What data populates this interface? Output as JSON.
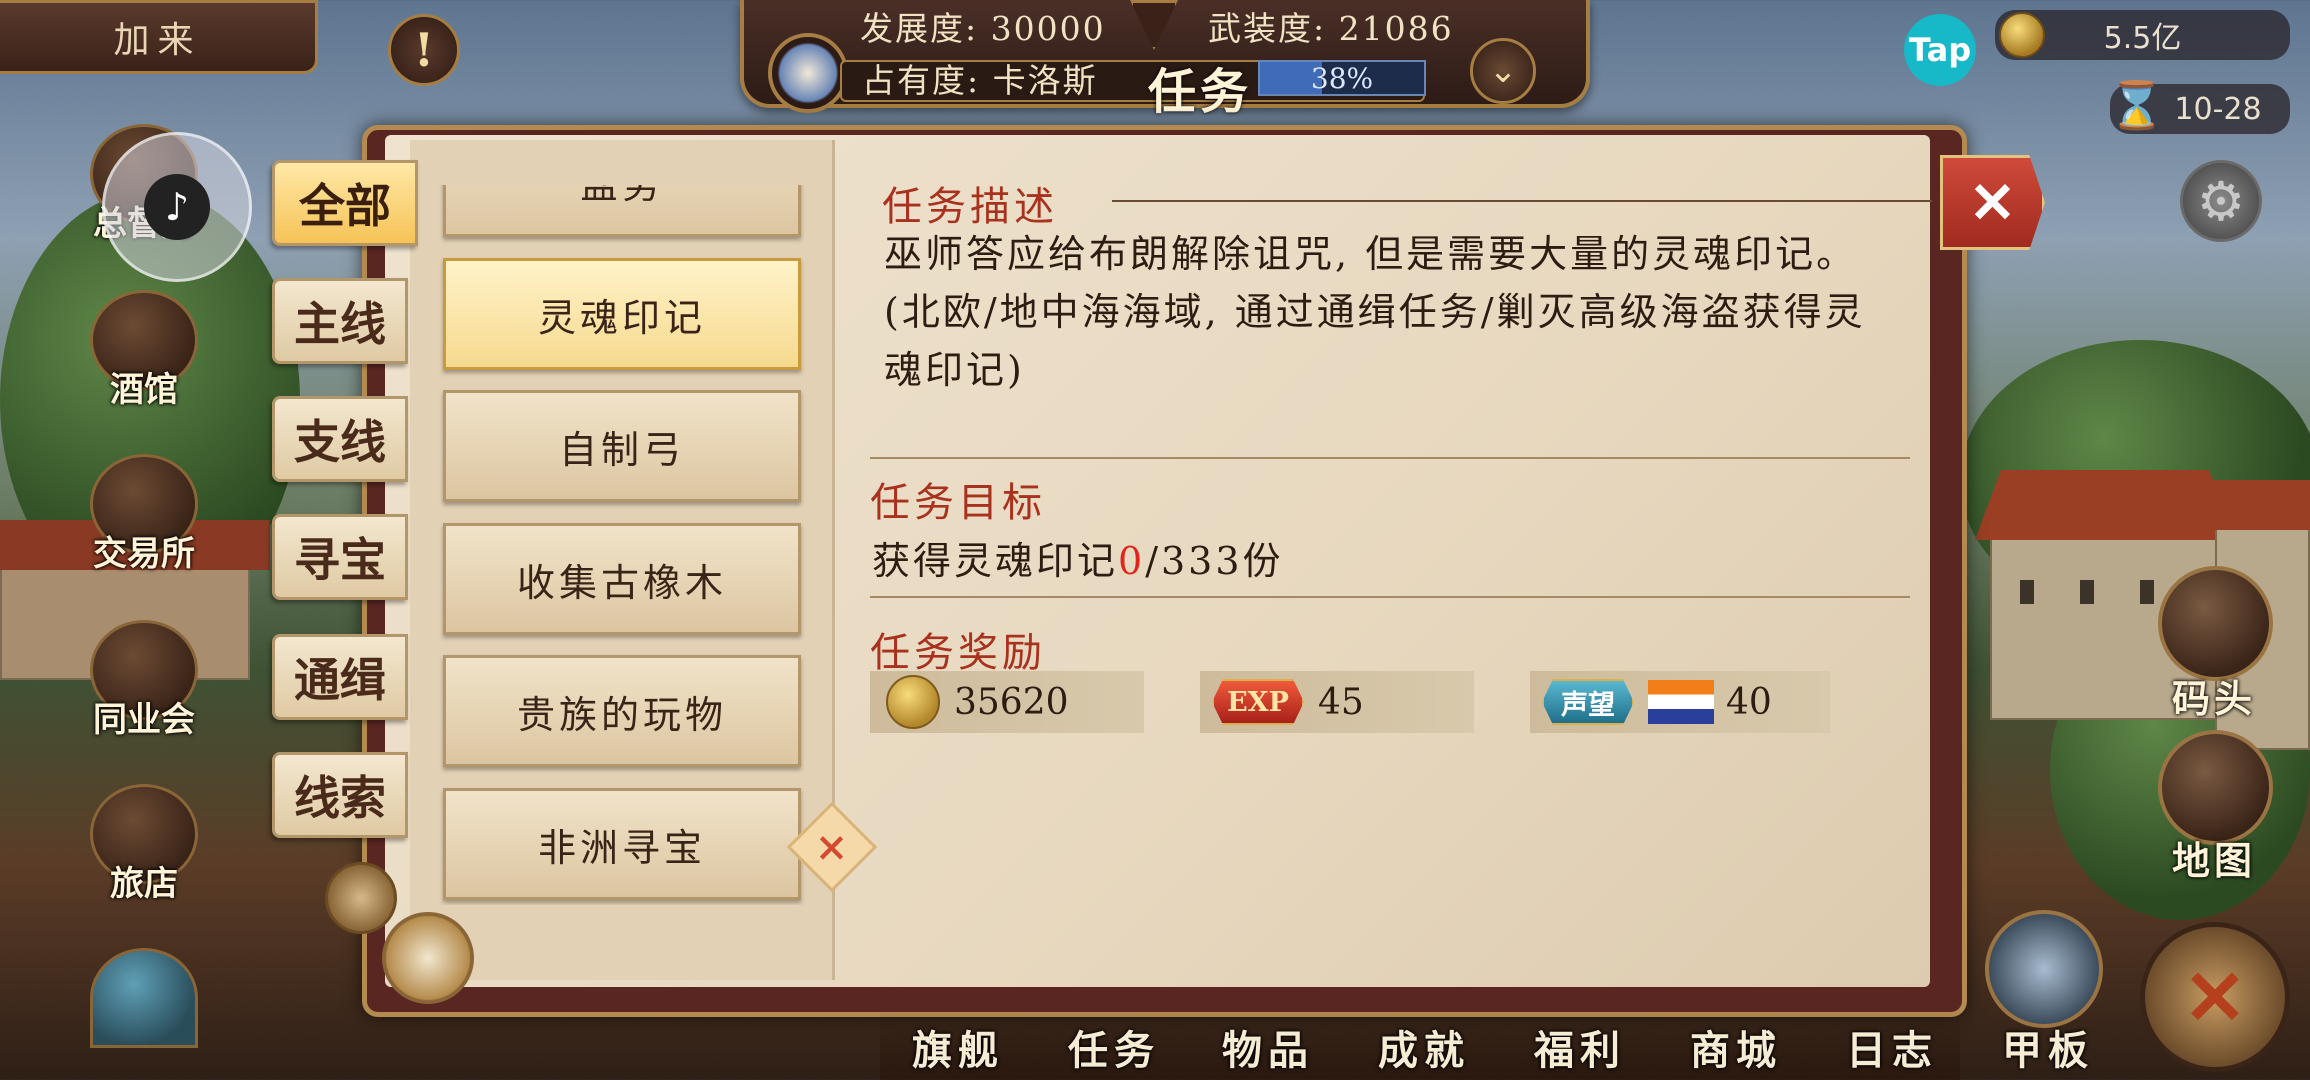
{
  "top": {
    "back_label": "加来",
    "development_label": "发展度: 30000",
    "armament_label": "武装度: 21086",
    "occupancy_label": "占有度: 卡洛斯",
    "occupancy_percent": "38%",
    "task_title": "任务"
  },
  "currency": {
    "gold": "5.5亿",
    "date": "10-28",
    "tap_label": "Tap"
  },
  "left_menu": [
    {
      "label": "总督府"
    },
    {
      "label": "酒馆"
    },
    {
      "label": "交易所"
    },
    {
      "label": "同业会"
    },
    {
      "label": "旅店"
    }
  ],
  "tabs": [
    "全部",
    "主线",
    "支线",
    "寻宝",
    "通缉",
    "线索"
  ],
  "selected_tab": 0,
  "task_list": [
    "盐务",
    "灵魂印记",
    "自制弓",
    "收集古橡木",
    "贵族的玩物",
    "非洲寻宝"
  ],
  "selected_task": 1,
  "detail": {
    "desc_title": "任务描述",
    "desc_text": "巫师答应给布朗解除诅咒, 但是需要大量的灵魂印记。 (北欧/地中海海域, 通过通缉任务/剿灭高级海盗获得灵魂印记)",
    "goal_title": "任务目标",
    "goal_prefix": "获得灵魂印记",
    "goal_current": "0",
    "goal_suffix": "/333份",
    "reward_title": "任务奖励",
    "rewards": {
      "gold": "35620",
      "exp_badge": "EXP",
      "exp": "45",
      "rep_badge": "声望",
      "rep": "40"
    }
  },
  "right_buttons": {
    "dock": "码头",
    "map": "地图"
  },
  "bottom_nav": [
    "旗舰",
    "任务",
    "物品",
    "成就",
    "福利",
    "商城",
    "日志",
    "甲板"
  ]
}
